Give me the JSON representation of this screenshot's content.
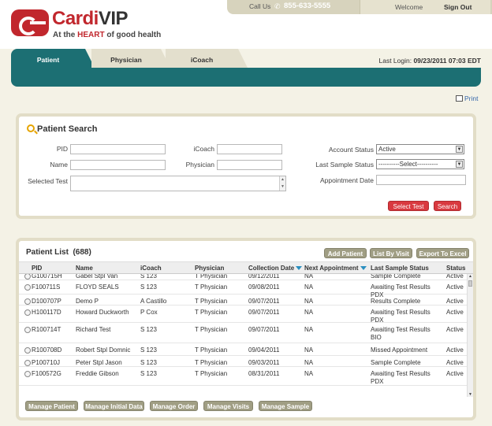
{
  "header": {
    "brand_main": "Cardi",
    "brand_vip": "VIP",
    "tagline_pre": "At the ",
    "tagline_heart": "HEART",
    "tagline_post": " of good health",
    "call_us": "Call Us",
    "phone": "855-633-5555",
    "welcome": "Welcome",
    "sign_out": "Sign Out"
  },
  "nav": {
    "tabs": [
      {
        "label": "Patient",
        "active": true
      },
      {
        "label": "Physician",
        "active": false
      },
      {
        "label": "iCoach",
        "active": false
      }
    ],
    "last_login_label": "Last Login:",
    "last_login_value": "09/23/2011 07:03 EDT"
  },
  "print": "Print",
  "search": {
    "title": "Patient Search",
    "pid_label": "PID",
    "name_label": "Name",
    "selected_test_label": "Selected Test",
    "icoach_label": "iCoach",
    "physician_label": "Physician",
    "account_status_label": "Account Status",
    "account_status_value": "Active",
    "last_sample_status_label": "Last Sample Status",
    "last_sample_status_value": "----------Select----------",
    "appointment_date_label": "Appointment Date",
    "select_test_button": "Select Test",
    "search_button": "Search"
  },
  "patient_list": {
    "title": "Patient List",
    "count": "(688)",
    "add_patient": "Add Patient",
    "list_by_visit": "List By Visit",
    "export": "Export To Excel",
    "columns": [
      "PID",
      "Name",
      "iCoach",
      "Physician",
      "Collection Date",
      "Next Appointment",
      "Last Sample Status",
      "Status"
    ],
    "rows": [
      {
        "pid": "G100715H",
        "name": "Gabel Stpl Van",
        "icoach": "S 123",
        "physician": "T Physician",
        "date": "09/12/2011",
        "next": "NA",
        "last_status": "Sample Complete",
        "status": "Active"
      },
      {
        "pid": "F100711S",
        "name": "FLOYD SEALS",
        "icoach": "S 123",
        "physician": "T Physician",
        "date": "09/08/2011",
        "next": "NA",
        "last_status": "Awaiting Test Results PDX",
        "status": "Active"
      },
      {
        "pid": "D100707P",
        "name": "Demo P",
        "icoach": "A Castillo",
        "physician": "T Physician",
        "date": "09/07/2011",
        "next": "NA",
        "last_status": "Results Complete",
        "status": "Active"
      },
      {
        "pid": "H100117D",
        "name": "Howard Duckworth",
        "icoach": "P Cox",
        "physician": "T Physician",
        "date": "09/07/2011",
        "next": "NA",
        "last_status": "Awaiting Test Results PDX",
        "status": "Active"
      },
      {
        "pid": "R100714T",
        "name": "Richard Test",
        "icoach": "S 123",
        "physician": "T Physician",
        "date": "09/07/2011",
        "next": "NA",
        "last_status": "Awaiting Test Results BIO",
        "status": "Active"
      },
      {
        "pid": "R100708D",
        "name": "Robert Stpl Domnic",
        "icoach": "S 123",
        "physician": "T Physician",
        "date": "09/04/2011",
        "next": "NA",
        "last_status": "Missed Appointment",
        "status": "Active"
      },
      {
        "pid": "P100710J",
        "name": "Peter Stpl Jason",
        "icoach": "S 123",
        "physician": "T Physician",
        "date": "09/03/2011",
        "next": "NA",
        "last_status": "Sample Complete",
        "status": "Active"
      },
      {
        "pid": "F100572G",
        "name": "Freddie Gibson",
        "icoach": "S 123",
        "physician": "T Physician",
        "date": "08/31/2011",
        "next": "NA",
        "last_status": "Awaiting Test Results PDX",
        "status": "Active"
      }
    ],
    "actions": [
      "Manage Patient",
      "Manage Initial Data",
      "Manage Order",
      "Manage Visits",
      "Manage Sample"
    ]
  }
}
